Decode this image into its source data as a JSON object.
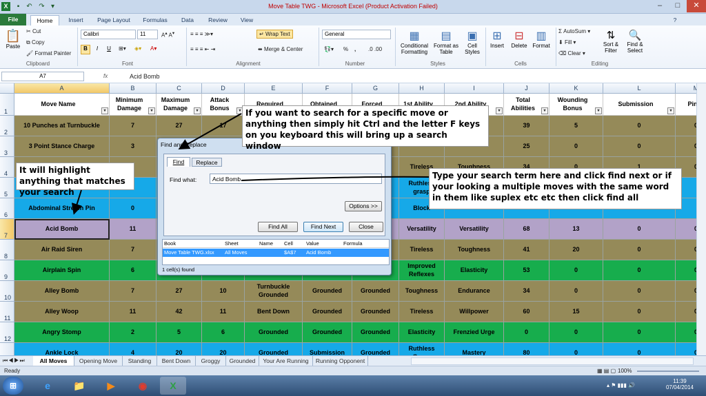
{
  "app": {
    "title": "Move Table TWG  -  Microsoft Excel (Product Activation Failed)"
  },
  "tabs": [
    "File",
    "Home",
    "Insert",
    "Page Layout",
    "Formulas",
    "Data",
    "Review",
    "View"
  ],
  "ribbon": {
    "clipboard": {
      "paste": "Paste",
      "cut": "Cut",
      "copy": "Copy",
      "painter": "Format Painter",
      "label": "Clipboard"
    },
    "font": {
      "name": "Calibri",
      "size": "11",
      "bold": "B",
      "italic": "I",
      "underline": "U",
      "label": "Font"
    },
    "alignment": {
      "wrap": "Wrap Text",
      "merge": "Merge & Center",
      "label": "Alignment"
    },
    "number": {
      "format": "General",
      "percent": "%",
      "comma": ",",
      "inc": ".0 .00",
      "label": "Number"
    },
    "styles": {
      "conditional": "Conditional Formatting",
      "format_table": "Format as Table",
      "cell_styles": "Cell Styles",
      "label": "Styles"
    },
    "cells": {
      "insert": "Insert",
      "delete": "Delete",
      "format": "Format",
      "label": "Cells"
    },
    "editing": {
      "autosum": "AutoSum",
      "fill": "Fill",
      "clear": "Clear",
      "sort": "Sort & Filter",
      "find": "Find & Select",
      "label": "Editing"
    }
  },
  "formula_bar": {
    "name_box": "A7",
    "fx": "fx",
    "value": "Acid Bomb"
  },
  "columns": [
    "A",
    "B",
    "C",
    "D",
    "E",
    "F",
    "G",
    "H",
    "I",
    "J",
    "K",
    "L",
    "M"
  ],
  "header_row": [
    "Move Name",
    "Minimum Damage",
    "Maximum Damage",
    "Attack Bonus",
    "Required",
    "Obtained",
    "Forced",
    "1st Ability",
    "2nd Ability",
    "Total Abilities",
    "Wounding Bonus",
    "Submission",
    "Pin"
  ],
  "rows": [
    {
      "num": "2",
      "color": "#958a59",
      "cells": [
        "10 Punches at Turnbuckle",
        "7",
        "27",
        "17",
        "",
        "",
        "",
        "",
        "",
        "39",
        "5",
        "0",
        "0"
      ]
    },
    {
      "num": "3",
      "color": "#958a59",
      "cells": [
        "3 Point Stance Charge",
        "3",
        "",
        "",
        "",
        "",
        "",
        "",
        "",
        "25",
        "0",
        "0",
        "0"
      ]
    },
    {
      "num": "4",
      "color": "#958a59",
      "cells": [
        "",
        "",
        "",
        "",
        "",
        "",
        "",
        "Tireless",
        "Toughness",
        "34",
        "0",
        "1",
        "0"
      ]
    },
    {
      "num": "5",
      "color": "#16a9e8",
      "cells": [
        "",
        "",
        "",
        "",
        "",
        "",
        "",
        "Ruthless grasp",
        "",
        "",
        "",
        "",
        ""
      ]
    },
    {
      "num": "6",
      "color": "#16a9e8",
      "cells": [
        "Abdominal Stretch Pin",
        "0",
        "",
        "",
        "",
        "",
        "",
        "Block",
        "",
        "",
        "",
        "",
        ""
      ]
    },
    {
      "num": "7",
      "color": "#b2a2c8",
      "cells": [
        "Acid Bomb",
        "11",
        "",
        "",
        "",
        "",
        "",
        "Versatility",
        "Versatility",
        "68",
        "13",
        "0",
        "0"
      ]
    },
    {
      "num": "8",
      "color": "#958a59",
      "cells": [
        "Air Raid Siren",
        "7",
        "",
        "",
        "",
        "",
        "",
        "Tireless",
        "Toughness",
        "41",
        "20",
        "0",
        "0"
      ]
    },
    {
      "num": "9",
      "color": "#17ad4d",
      "cells": [
        "Airplain Spin",
        "6",
        "",
        "",
        "",
        "",
        "",
        "Improved Reflexes",
        "Elasticity",
        "53",
        "0",
        "0",
        "0"
      ]
    },
    {
      "num": "10",
      "color": "#958a59",
      "cells": [
        "Alley Bomb",
        "7",
        "27",
        "10",
        "Turnbuckle Grounded",
        "Grounded",
        "Grounded",
        "Toughness",
        "Endurance",
        "34",
        "0",
        "0",
        "0"
      ]
    },
    {
      "num": "11",
      "color": "#958a59",
      "cells": [
        "Alley Woop",
        "11",
        "42",
        "11",
        "Bent Down",
        "Grounded",
        "Grounded",
        "Tireless",
        "Willpower",
        "60",
        "15",
        "0",
        "0"
      ]
    },
    {
      "num": "12",
      "color": "#17ad4d",
      "cells": [
        "Angry Stomp",
        "2",
        "5",
        "6",
        "Grounded",
        "Grounded",
        "Grounded",
        "Elasticity",
        "Frenzied Urge",
        "0",
        "0",
        "0",
        "0"
      ]
    },
    {
      "num": "13",
      "color": "#16a9e8",
      "cells": [
        "Ankle Lock",
        "4",
        "20",
        "20",
        "Grounded",
        "Submission",
        "Grounded",
        "Ruthless Grasp",
        "Mastery",
        "80",
        "0",
        "0",
        "0"
      ]
    }
  ],
  "sheets": [
    "All Moves",
    "Opening Move",
    "Standing",
    "Bent Down",
    "Groggy",
    "Grounded",
    "Your Are Running",
    "Running Opponent"
  ],
  "status": {
    "left": "Ready",
    "zoom": "100%"
  },
  "taskbar": {
    "time": "11:39",
    "date": "07/04/2014"
  },
  "dialog": {
    "title": "Find and Replace",
    "tab_find": "Find",
    "tab_replace": "Replace",
    "find_what_label": "Find what:",
    "find_what": "Acid Bomb",
    "options": "Options >>",
    "find_all": "Find All",
    "find_next": "Find Next",
    "close": "Close",
    "result_headers": [
      "Book",
      "Sheet",
      "Name",
      "Cell",
      "Value",
      "Formula"
    ],
    "result": [
      "Move Table TWG.xlsx",
      "All Moves",
      "",
      "$A$7",
      "Acid Bomb",
      ""
    ],
    "count": "1 cell(s) found"
  },
  "callouts": {
    "top": "If you want to search for a specific move or anything then simply hit Ctrl and the letter F keys on you keyboard this will bring up a search window",
    "left": "It will highlight anything that matches your search",
    "right": "Type your search term here and click find next or if your looking a multiple moves with the same word in them like suplex etc etc then click find all"
  }
}
